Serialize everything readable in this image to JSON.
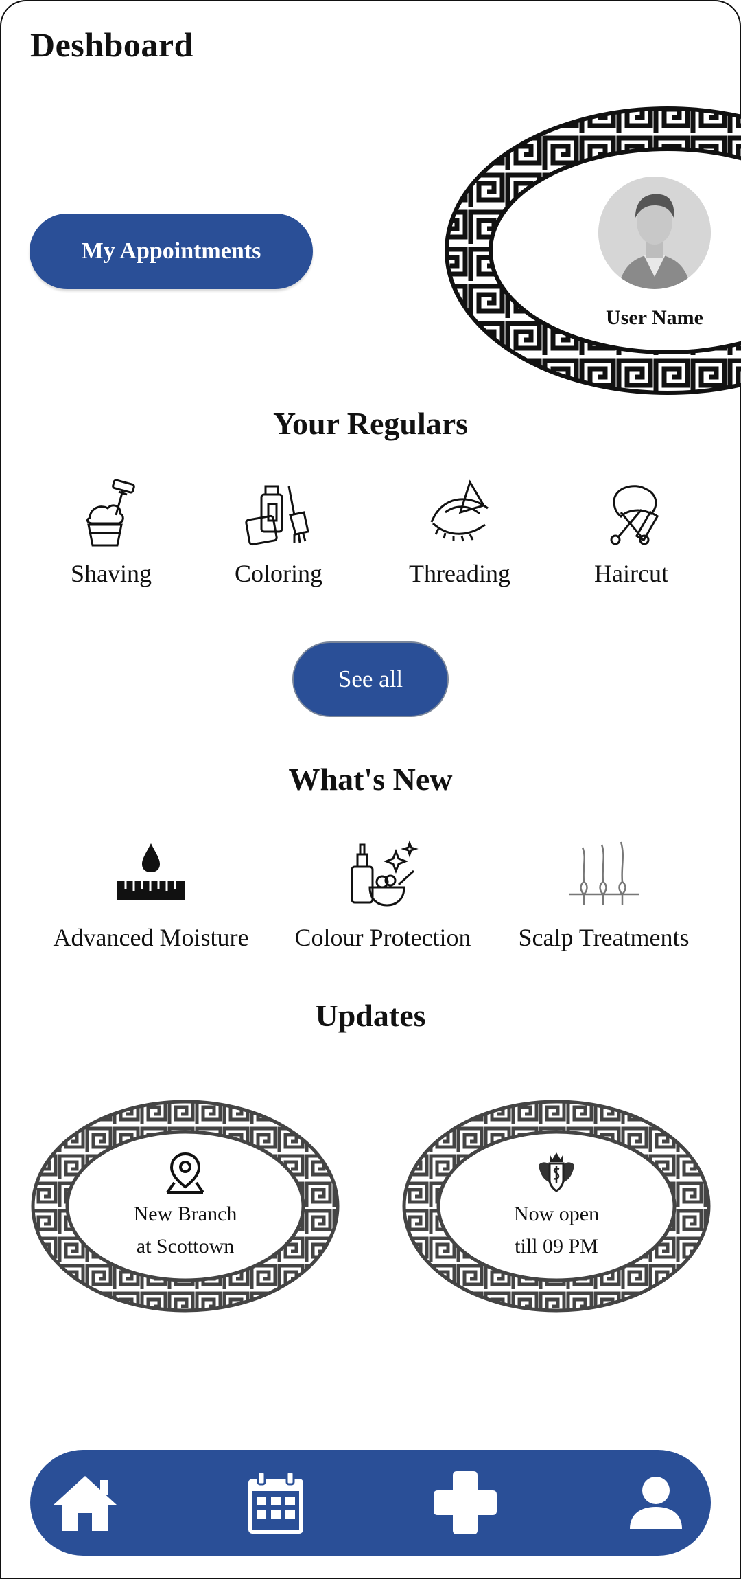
{
  "header": {
    "title": "Deshboard"
  },
  "profile": {
    "appointments_label": "My Appointments",
    "user_name": "User Name"
  },
  "regulars": {
    "title": "Your Regulars",
    "items": [
      {
        "label": "Shaving",
        "icon": "shaving-icon"
      },
      {
        "label": "Coloring",
        "icon": "coloring-icon"
      },
      {
        "label": "Threading",
        "icon": "threading-icon"
      },
      {
        "label": "Haircut",
        "icon": "haircut-icon"
      }
    ],
    "see_all_label": "See all"
  },
  "whats_new": {
    "title": "What's New",
    "items": [
      {
        "label": "Advanced Moisture",
        "icon": "moisture-icon"
      },
      {
        "label": "Colour Protection",
        "icon": "colour-protection-icon"
      },
      {
        "label": "Scalp Treatments",
        "icon": "scalp-treatment-icon"
      }
    ]
  },
  "updates": {
    "title": "Updates",
    "cards": [
      {
        "line1": "New Branch",
        "line2": "at Scottown",
        "icon": "location-pin-icon"
      },
      {
        "line1": "Now open",
        "line2": "till 09 PM",
        "icon": "crest-icon"
      }
    ]
  },
  "nav": {
    "items": [
      {
        "name": "home",
        "icon": "home-icon"
      },
      {
        "name": "calendar",
        "icon": "calendar-icon"
      },
      {
        "name": "add",
        "icon": "plus-icon"
      },
      {
        "name": "profile",
        "icon": "user-icon"
      }
    ]
  },
  "colors": {
    "primary": "#2a4f97",
    "background": "#ffffff",
    "text": "#111111"
  }
}
